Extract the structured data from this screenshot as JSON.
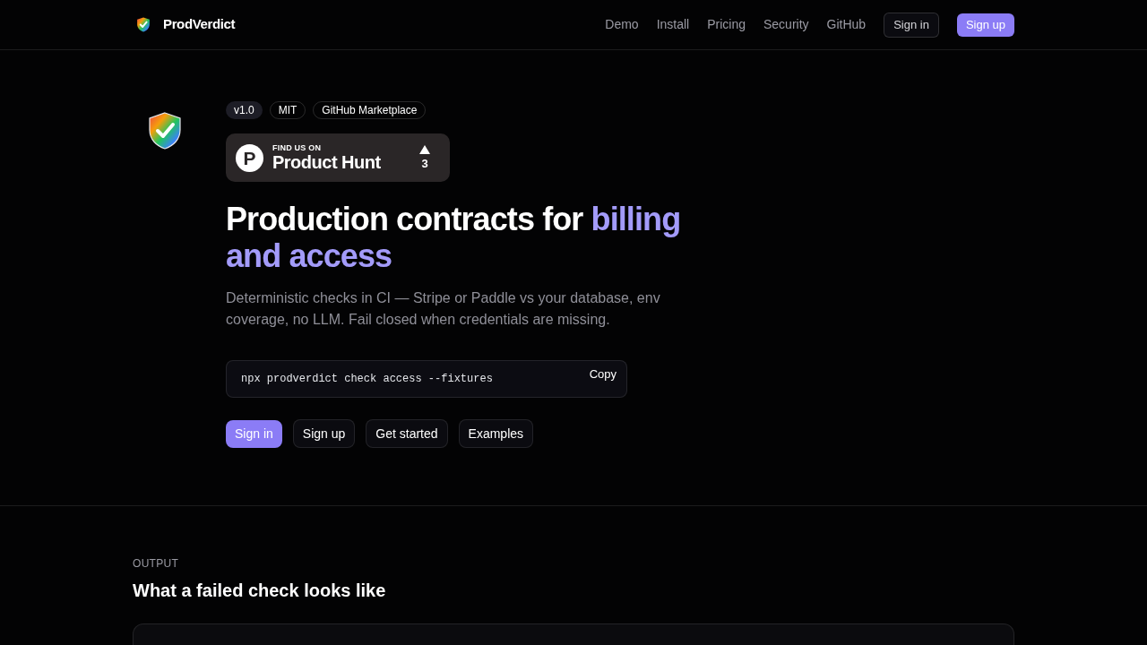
{
  "header": {
    "brand": "ProdVerdict",
    "links": [
      "Demo",
      "Install",
      "Pricing",
      "Security",
      "GitHub"
    ],
    "buttons": [
      {
        "label": "Sign in",
        "kind": "outline"
      },
      {
        "label": "Sign up",
        "kind": "primary"
      }
    ]
  },
  "hero": {
    "badges": [
      {
        "label": "v1.0",
        "kind": "filled"
      },
      {
        "label": "MIT",
        "kind": "outline"
      },
      {
        "label": "GitHub Marketplace",
        "kind": "outline"
      }
    ],
    "product_hunt": {
      "logo_letter": "P",
      "kicker": "FIND US ON",
      "name": "Product Hunt",
      "upvotes": "3"
    },
    "title": {
      "text": "Production contracts for",
      "highlight": "billing and access"
    },
    "description": "Deterministic checks in CI — Stripe or Paddle vs your database, env coverage, no LLM. Fail closed when credentials are missing.",
    "command": {
      "code": "npx prodverdict check access --fixtures",
      "copy_label": "Copy"
    },
    "buttons": [
      {
        "label": "Sign in",
        "kind": "primary"
      },
      {
        "label": "Sign up",
        "kind": "secondary"
      },
      {
        "label": "Get started",
        "kind": "secondary"
      },
      {
        "label": "Examples",
        "kind": "secondary"
      }
    ]
  },
  "output_section": {
    "eyebrow": "OUTPUT",
    "title": "What a failed check looks like"
  }
}
